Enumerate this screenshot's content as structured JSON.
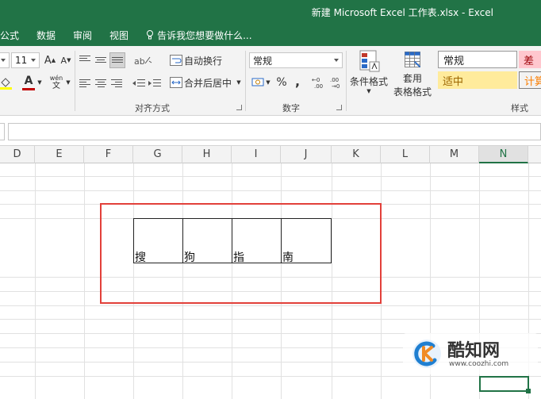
{
  "window": {
    "title": "新建 Microsoft Excel 工作表.xlsx - Excel"
  },
  "tabs": [
    "公式",
    "数据",
    "审阅",
    "视图"
  ],
  "tell_me": "告诉我您想要做什么...",
  "ribbon": {
    "font_size": "11",
    "font_grow": "A",
    "font_shrink": "A",
    "font_color_letter": "A",
    "wen_label": "wén",
    "wrap_text": "自动换行",
    "merge_center": "合并后居中",
    "number_format": "常规",
    "percent": "%",
    "comma": ",",
    "conditional_format": "条件格式",
    "table_format_line1": "套用",
    "table_format_line2": "表格格式",
    "groups": {
      "alignment": "对齐方式",
      "number": "数字",
      "styles": "样式"
    },
    "styles": {
      "normal": "常规",
      "bad": "差",
      "neutral": "适中",
      "calc": "计算"
    },
    "colors": {
      "green": "#217346",
      "bad_bg": "#ffc7ce",
      "bad_fg": "#9c0006",
      "neutral_bg": "#ffeb9c",
      "neutral_fg": "#9c6500",
      "calc_fg": "#fa7d00",
      "highlight": "#e2403a"
    }
  },
  "columns": [
    "D",
    "E",
    "F",
    "G",
    "H",
    "I",
    "J",
    "K",
    "L",
    "M",
    "N"
  ],
  "cells": [
    "搜",
    "狗",
    "指",
    "南"
  ],
  "watermark": {
    "name": "酷知网",
    "url": "www.coozhi.com"
  }
}
